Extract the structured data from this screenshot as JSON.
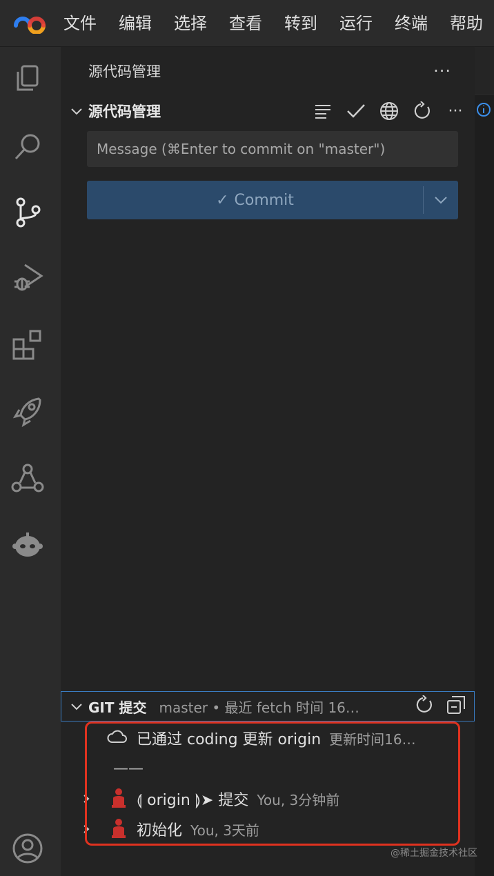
{
  "menubar": {
    "items": [
      "文件",
      "编辑",
      "选择",
      "查看",
      "转到",
      "运行",
      "终端",
      "帮助"
    ]
  },
  "activity_bar": {
    "icons": [
      "explorer-icon",
      "search-icon",
      "source-control-icon",
      "run-debug-icon",
      "extensions-icon",
      "rocket-icon",
      "share-icon",
      "mascot-icon",
      "account-icon"
    ]
  },
  "sidebar": {
    "title": "源代码管理",
    "more": "···",
    "scm_section": {
      "title": "源代码管理",
      "more": "···"
    },
    "message": {
      "placeholder": "Message (⌘Enter to commit on \"master\")"
    },
    "commit_button": {
      "check": "✓",
      "label": "Commit"
    },
    "git_section": {
      "title": "GIT 提交",
      "description": "master • 最近 fetch 时间 16…"
    },
    "commits": [
      {
        "kind": "sync",
        "text": "已通过 coding 更新 origin",
        "sub": "更新时间16…"
      },
      {
        "kind": "separator",
        "text": "——"
      },
      {
        "kind": "commit",
        "text": "⟬ origin ⟭➤  提交",
        "sub": "You, 3分钟前"
      },
      {
        "kind": "commit",
        "text": "初始化",
        "sub": "You, 3天前"
      }
    ]
  },
  "watermark": "@稀土掘金技术社区",
  "colors": {
    "highlight": "#e0321f",
    "commit_button_bg": "#2b4a6b",
    "focus_border": "#3a7cc2"
  }
}
